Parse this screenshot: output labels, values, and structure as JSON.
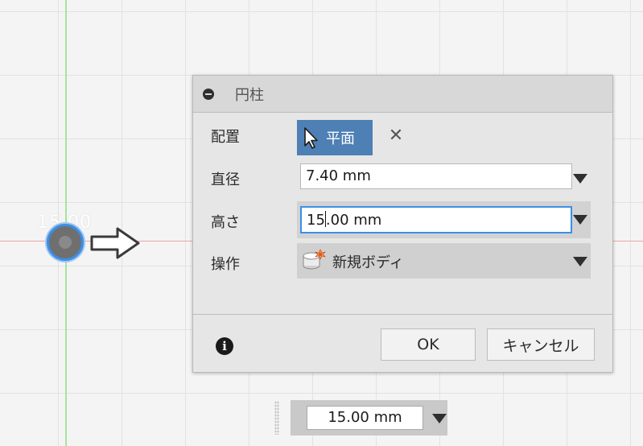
{
  "viewport": {
    "ghost_dimension": "15.00"
  },
  "dialog": {
    "title": "円柱",
    "rows": {
      "placement": {
        "label": "配置",
        "button_label": "平面",
        "clear_symbol": "✕"
      },
      "diameter": {
        "label": "直径",
        "value": "7.40 mm"
      },
      "height": {
        "label": "高さ",
        "value_before_caret": "15",
        "value_after_caret": ".00 mm"
      },
      "operation": {
        "label": "操作",
        "selected": "新規ボディ"
      }
    },
    "buttons": {
      "ok": "OK",
      "cancel": "キャンセル"
    },
    "info_symbol": "i"
  },
  "bottom_input": {
    "value": "15.00 mm"
  },
  "colors": {
    "accent_blue": "#4e7fb5",
    "focus_blue": "#3d8ee8",
    "axis_green": "#a6e3a0",
    "axis_red": "#f2a3a3"
  }
}
